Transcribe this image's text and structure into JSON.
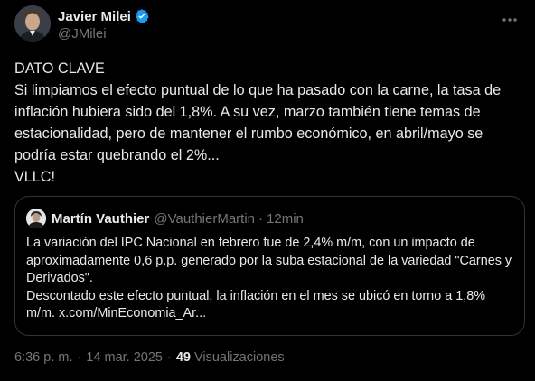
{
  "tweet": {
    "author": {
      "display_name": "Javier Milei",
      "handle": "@JMilei",
      "verified": true
    },
    "text": "DATO CLAVE\nSi limpiamos el efecto puntual de lo que ha pasado con la carne, la tasa de inflación hubiera sido del 1,8%. A su vez, marzo también tiene temas de estacionalidad, pero de mantener el rumbo económico, en abril/mayo se podría estar quebrando el 2%...\nVLLC!",
    "quoted": {
      "display_name": "Martín Vauthier",
      "handle": "@VauthierMartin",
      "separator": "·",
      "time": "12min",
      "text": "La variación del IPC Nacional en febrero fue de 2,4% m/m, con un impacto de aproximadamente 0,6 p.p. generado por la suba estacional de la variedad \"Carnes y Derivados\".\nDescontado este efecto puntual, la inflación en el mes se ubicó en torno a 1,8% m/m. x.com/MinEconomia_Ar..."
    },
    "meta": {
      "time": "6:36 p. m.",
      "separator": "·",
      "date": "14 mar. 2025",
      "views_count": "49",
      "views_label": "Visualizaciones"
    }
  },
  "icons": {
    "verified": "verified-badge-icon",
    "more": "more-options-icon"
  },
  "colors": {
    "background": "#000000",
    "text_primary": "#e7e9ea",
    "text_secondary": "#71767b",
    "border": "#2f3336",
    "verified_blue": "#1d9bf0"
  }
}
